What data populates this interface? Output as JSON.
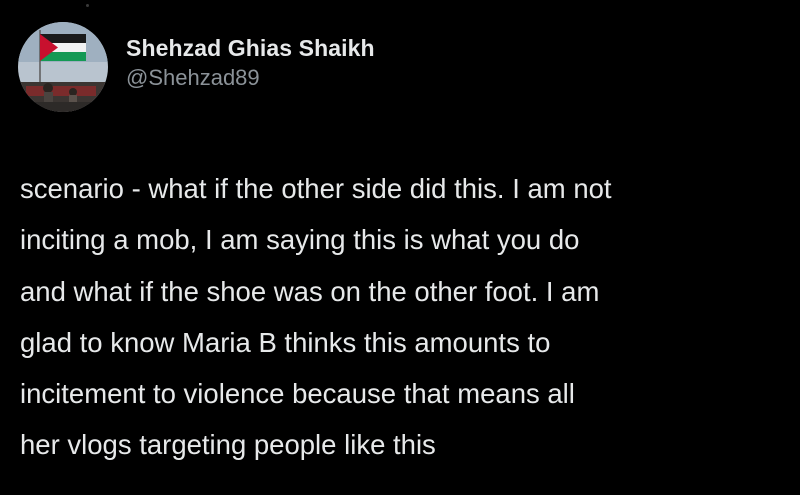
{
  "author": {
    "display_name": "Shehzad Ghias Shaikh",
    "handle": "@Shehzad89",
    "avatar_icon": "profile-photo-with-palestine-flag"
  },
  "tweet": {
    "lines": [
      "scenario - what if the other side did this. I am not",
      "inciting a mob, I am saying this is what you do",
      "and what if the shoe was on the other foot. I am",
      "glad to know Maria B thinks this amounts to",
      "incitement to violence because that means all",
      "her vlogs targeting people like this"
    ]
  },
  "colors": {
    "background": "#000000",
    "text_primary": "#e7e9ea",
    "text_secondary": "#8b9298",
    "flag_red": "#c8102e",
    "flag_green": "#149954"
  }
}
